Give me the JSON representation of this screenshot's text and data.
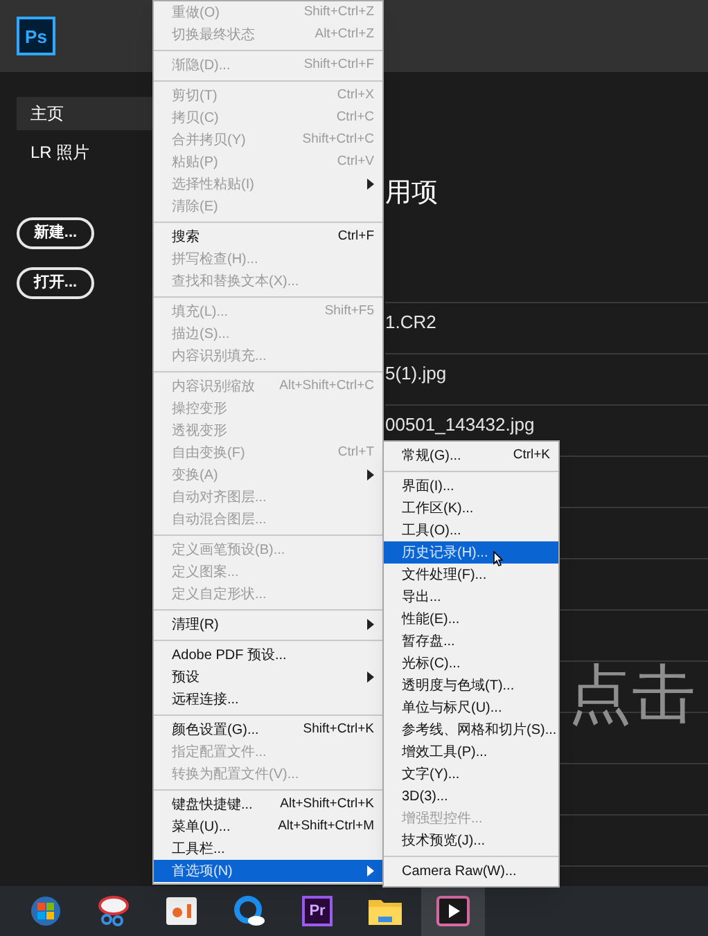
{
  "app": {
    "logo": "Ps"
  },
  "sidebar": {
    "items": [
      {
        "label": "主页",
        "selected": true
      },
      {
        "label": "LR 照片",
        "selected": false
      }
    ],
    "buttons": [
      "新建...",
      "打开..."
    ]
  },
  "main": {
    "heading": "用项",
    "recent_files": [
      "1.CR2",
      "5(1).jpg",
      "00501_143432.jpg"
    ],
    "overlay_text": "点击"
  },
  "edit_menu": {
    "items": [
      {
        "kind": "item",
        "label": "重做(O)",
        "shortcut": "Shift+Ctrl+Z",
        "disabled": true,
        "submenu": false,
        "selected": false
      },
      {
        "kind": "item",
        "label": "切换最终状态",
        "shortcut": "Alt+Ctrl+Z",
        "disabled": true,
        "submenu": false,
        "selected": false
      },
      {
        "kind": "separator"
      },
      {
        "kind": "item",
        "label": "渐隐(D)...",
        "shortcut": "Shift+Ctrl+F",
        "disabled": true,
        "submenu": false,
        "selected": false
      },
      {
        "kind": "separator"
      },
      {
        "kind": "item",
        "label": "剪切(T)",
        "shortcut": "Ctrl+X",
        "disabled": true,
        "submenu": false,
        "selected": false
      },
      {
        "kind": "item",
        "label": "拷贝(C)",
        "shortcut": "Ctrl+C",
        "disabled": true,
        "submenu": false,
        "selected": false
      },
      {
        "kind": "item",
        "label": "合并拷贝(Y)",
        "shortcut": "Shift+Ctrl+C",
        "disabled": true,
        "submenu": false,
        "selected": false
      },
      {
        "kind": "item",
        "label": "粘贴(P)",
        "shortcut": "Ctrl+V",
        "disabled": true,
        "submenu": false,
        "selected": false
      },
      {
        "kind": "item",
        "label": "选择性粘贴(I)",
        "disabled": true,
        "submenu": true,
        "selected": false
      },
      {
        "kind": "item",
        "label": "清除(E)",
        "disabled": true,
        "submenu": false,
        "selected": false
      },
      {
        "kind": "separator"
      },
      {
        "kind": "item",
        "label": "搜索",
        "shortcut": "Ctrl+F",
        "disabled": false,
        "submenu": false,
        "selected": false
      },
      {
        "kind": "item",
        "label": "拼写检查(H)...",
        "disabled": true,
        "submenu": false,
        "selected": false
      },
      {
        "kind": "item",
        "label": "查找和替换文本(X)...",
        "disabled": true,
        "submenu": false,
        "selected": false
      },
      {
        "kind": "separator"
      },
      {
        "kind": "item",
        "label": "填充(L)...",
        "shortcut": "Shift+F5",
        "disabled": true,
        "submenu": false,
        "selected": false
      },
      {
        "kind": "item",
        "label": "描边(S)...",
        "disabled": true,
        "submenu": false,
        "selected": false
      },
      {
        "kind": "item",
        "label": "内容识别填充...",
        "disabled": true,
        "submenu": false,
        "selected": false
      },
      {
        "kind": "separator"
      },
      {
        "kind": "item",
        "label": "内容识别缩放",
        "shortcut": "Alt+Shift+Ctrl+C",
        "disabled": true,
        "submenu": false,
        "selected": false
      },
      {
        "kind": "item",
        "label": "操控变形",
        "disabled": true,
        "submenu": false,
        "selected": false
      },
      {
        "kind": "item",
        "label": "透视变形",
        "disabled": true,
        "submenu": false,
        "selected": false
      },
      {
        "kind": "item",
        "label": "自由变换(F)",
        "shortcut": "Ctrl+T",
        "disabled": true,
        "submenu": false,
        "selected": false
      },
      {
        "kind": "item",
        "label": "变换(A)",
        "disabled": true,
        "submenu": true,
        "selected": false
      },
      {
        "kind": "item",
        "label": "自动对齐图层...",
        "disabled": true,
        "submenu": false,
        "selected": false
      },
      {
        "kind": "item",
        "label": "自动混合图层...",
        "disabled": true,
        "submenu": false,
        "selected": false
      },
      {
        "kind": "separator"
      },
      {
        "kind": "item",
        "label": "定义画笔预设(B)...",
        "disabled": true,
        "submenu": false,
        "selected": false
      },
      {
        "kind": "item",
        "label": "定义图案...",
        "disabled": true,
        "submenu": false,
        "selected": false
      },
      {
        "kind": "item",
        "label": "定义自定形状...",
        "disabled": true,
        "submenu": false,
        "selected": false
      },
      {
        "kind": "separator"
      },
      {
        "kind": "item",
        "label": "清理(R)",
        "disabled": false,
        "submenu": true,
        "selected": false
      },
      {
        "kind": "separator"
      },
      {
        "kind": "item",
        "label": "Adobe PDF 预设...",
        "disabled": false,
        "submenu": false,
        "selected": false
      },
      {
        "kind": "item",
        "label": "预设",
        "disabled": false,
        "submenu": true,
        "selected": false
      },
      {
        "kind": "item",
        "label": "远程连接...",
        "disabled": false,
        "submenu": false,
        "selected": false
      },
      {
        "kind": "separator"
      },
      {
        "kind": "item",
        "label": "颜色设置(G)...",
        "shortcut": "Shift+Ctrl+K",
        "disabled": false,
        "submenu": false,
        "selected": false
      },
      {
        "kind": "item",
        "label": "指定配置文件...",
        "disabled": true,
        "submenu": false,
        "selected": false
      },
      {
        "kind": "item",
        "label": "转换为配置文件(V)...",
        "disabled": true,
        "submenu": false,
        "selected": false
      },
      {
        "kind": "separator"
      },
      {
        "kind": "item",
        "label": "键盘快捷键...",
        "shortcut": "Alt+Shift+Ctrl+K",
        "disabled": false,
        "submenu": false,
        "selected": false
      },
      {
        "kind": "item",
        "label": "菜单(U)...",
        "shortcut": "Alt+Shift+Ctrl+M",
        "disabled": false,
        "submenu": false,
        "selected": false
      },
      {
        "kind": "item",
        "label": "工具栏...",
        "disabled": false,
        "submenu": false,
        "selected": false
      },
      {
        "kind": "item",
        "label": "首选项(N)",
        "disabled": false,
        "submenu": true,
        "selected": true
      }
    ]
  },
  "preferences_submenu": {
    "items": [
      {
        "kind": "item",
        "label": "常规(G)...",
        "shortcut": "Ctrl+K",
        "disabled": false,
        "selected": false
      },
      {
        "kind": "separator"
      },
      {
        "kind": "item",
        "label": "界面(I)...",
        "disabled": false,
        "selected": false
      },
      {
        "kind": "item",
        "label": "工作区(K)...",
        "disabled": false,
        "selected": false
      },
      {
        "kind": "item",
        "label": "工具(O)...",
        "disabled": false,
        "selected": false
      },
      {
        "kind": "item",
        "label": "历史记录(H)...",
        "disabled": false,
        "selected": true
      },
      {
        "kind": "item",
        "label": "文件处理(F)...",
        "disabled": false,
        "selected": false
      },
      {
        "kind": "item",
        "label": "导出...",
        "disabled": false,
        "selected": false
      },
      {
        "kind": "item",
        "label": "性能(E)...",
        "disabled": false,
        "selected": false
      },
      {
        "kind": "item",
        "label": "暂存盘...",
        "disabled": false,
        "selected": false
      },
      {
        "kind": "item",
        "label": "光标(C)...",
        "disabled": false,
        "selected": false
      },
      {
        "kind": "item",
        "label": "透明度与色域(T)...",
        "disabled": false,
        "selected": false
      },
      {
        "kind": "item",
        "label": "单位与标尺(U)...",
        "disabled": false,
        "selected": false
      },
      {
        "kind": "item",
        "label": "参考线、网格和切片(S)...",
        "disabled": false,
        "selected": false
      },
      {
        "kind": "item",
        "label": "增效工具(P)...",
        "disabled": false,
        "selected": false
      },
      {
        "kind": "item",
        "label": "文字(Y)...",
        "disabled": false,
        "selected": false
      },
      {
        "kind": "item",
        "label": "3D(3)...",
        "disabled": false,
        "selected": false
      },
      {
        "kind": "item",
        "label": "增强型控件...",
        "disabled": true,
        "selected": false
      },
      {
        "kind": "item",
        "label": "技术预览(J)...",
        "disabled": false,
        "selected": false
      },
      {
        "kind": "separator"
      },
      {
        "kind": "item",
        "label": "Camera Raw(W)...",
        "disabled": false,
        "selected": false
      }
    ]
  },
  "taskbar": {
    "apps": [
      {
        "kind": "windows",
        "selected": false
      },
      {
        "kind": "scissors",
        "selected": false
      },
      {
        "kind": "slides",
        "selected": false
      },
      {
        "kind": "cloud",
        "selected": false
      },
      {
        "kind": "premiere",
        "label": "Pr",
        "selected": false
      },
      {
        "kind": "folder",
        "selected": false
      },
      {
        "kind": "video",
        "selected": true
      }
    ]
  }
}
